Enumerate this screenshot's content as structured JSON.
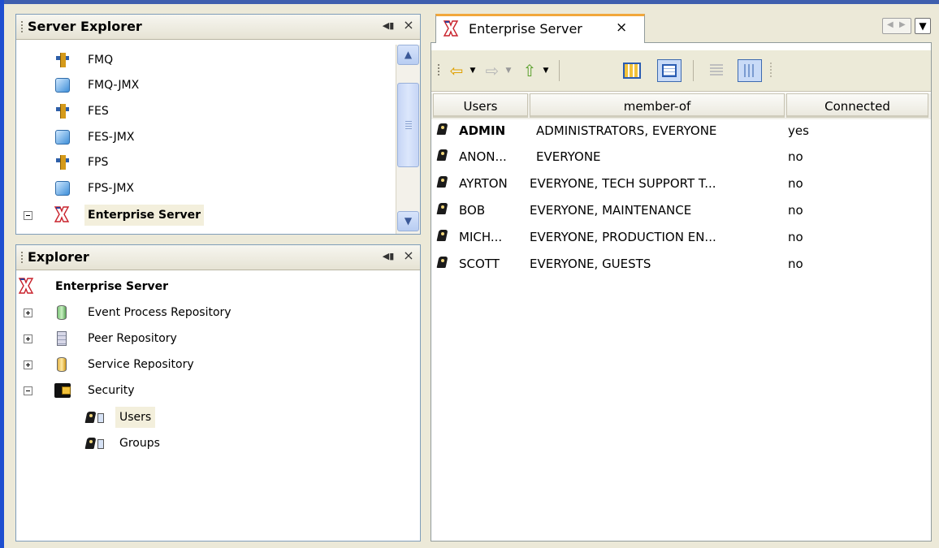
{
  "server_explorer": {
    "title": "Server Explorer",
    "items": [
      {
        "label": "FMQ",
        "icon": "server-component-icon"
      },
      {
        "label": "FMQ-JMX",
        "icon": "cube-icon"
      },
      {
        "label": "FES",
        "icon": "server-component-icon"
      },
      {
        "label": "FES-JMX",
        "icon": "cube-icon"
      },
      {
        "label": "FPS",
        "icon": "server-component-icon"
      },
      {
        "label": "FPS-JMX",
        "icon": "cube-icon"
      },
      {
        "label": "Enterprise Server",
        "icon": "enterprise-server-icon",
        "expanded": true,
        "selected": true
      }
    ]
  },
  "explorer": {
    "title": "Explorer",
    "root": "Enterprise Server",
    "items": [
      {
        "label": "Event Process Repository",
        "expanded": false
      },
      {
        "label": "Peer Repository",
        "expanded": false
      },
      {
        "label": "Service Repository",
        "expanded": false
      },
      {
        "label": "Security",
        "expanded": true
      }
    ],
    "security_children": [
      {
        "label": "Users",
        "selected": true
      },
      {
        "label": "Groups"
      }
    ]
  },
  "editor": {
    "tab_title": "Enterprise Server",
    "columns": [
      "Users",
      "member-of",
      "Connected"
    ],
    "rows": [
      {
        "user": "ADMIN",
        "member_of": "ADMINISTRATORS, EVERYONE",
        "connected": "yes"
      },
      {
        "user": "ANON...",
        "member_of": "EVERYONE",
        "connected": "no"
      },
      {
        "user": "AYRTON",
        "member_of": "EVERYONE, TECH SUPPORT T...",
        "connected": "no"
      },
      {
        "user": "BOB",
        "member_of": "EVERYONE, MAINTENANCE",
        "connected": "no"
      },
      {
        "user": "MICH...",
        "member_of": "EVERYONE, PRODUCTION EN...",
        "connected": "no"
      },
      {
        "user": "SCOTT",
        "member_of": "EVERYONE, GUESTS",
        "connected": "no"
      }
    ]
  },
  "colors": {
    "accent": "#1f4fd0",
    "tab_highlight": "#f2a73b",
    "selection": "#f3efdc"
  }
}
